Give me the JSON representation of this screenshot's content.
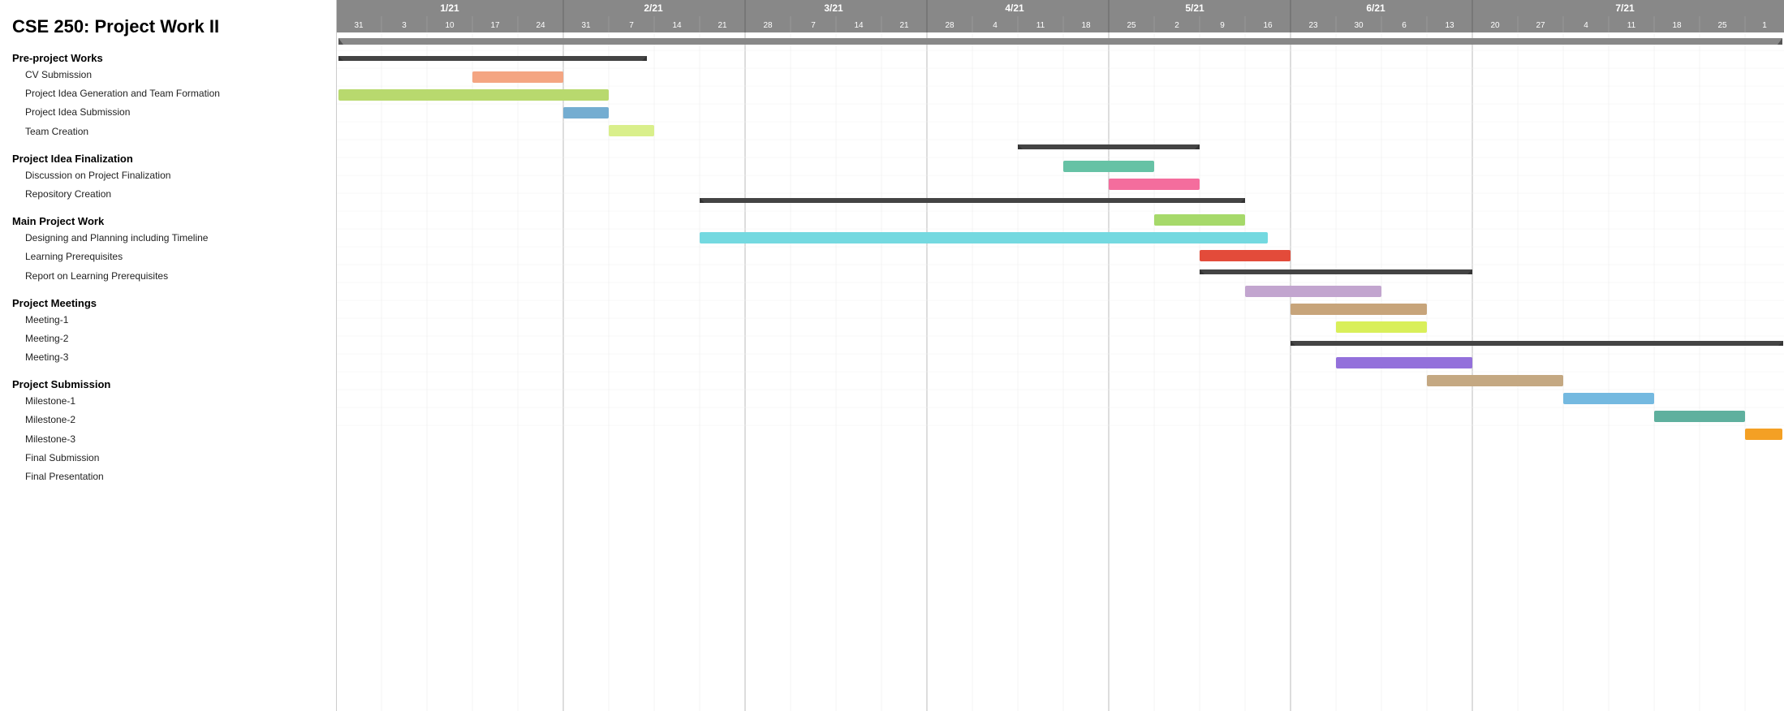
{
  "title": "CSE 250: Project Work II",
  "sections": [
    {
      "name": "Pre-project Works",
      "tasks": [
        "CV Submission",
        "Project Idea Generation and Team Formation",
        "Project Idea Submission",
        "Team Creation"
      ]
    },
    {
      "name": "Project Idea Finalization",
      "tasks": [
        "Discussion on Project Finalization",
        "Repository Creation"
      ]
    },
    {
      "name": "Main Project Work",
      "tasks": [
        "Designing and Planning including Timeline",
        "Learning Prerequisites",
        "Report on Learning Prerequisites"
      ]
    },
    {
      "name": "Project Meetings",
      "tasks": [
        "Meeting-1",
        "Meeting-2",
        "Meeting-3"
      ]
    },
    {
      "name": "Project Submission",
      "tasks": [
        "Milestone-1",
        "Milestone-2",
        "Milestone-3",
        "Final Submission",
        "Final Presentation"
      ]
    }
  ],
  "months": [
    "1/21",
    "2/21",
    "3/21",
    "4/21",
    "5/21",
    "6/21",
    "7/21"
  ],
  "dates": [
    "31",
    "3",
    "10",
    "17",
    "24",
    "31",
    "7",
    "14",
    "21",
    "28",
    "7",
    "14",
    "21",
    "28",
    "4",
    "11",
    "18",
    "25",
    "2",
    "9",
    "16",
    "23",
    "30",
    "6",
    "13",
    "20",
    "27",
    "4",
    "11",
    "18",
    "25",
    "1"
  ]
}
